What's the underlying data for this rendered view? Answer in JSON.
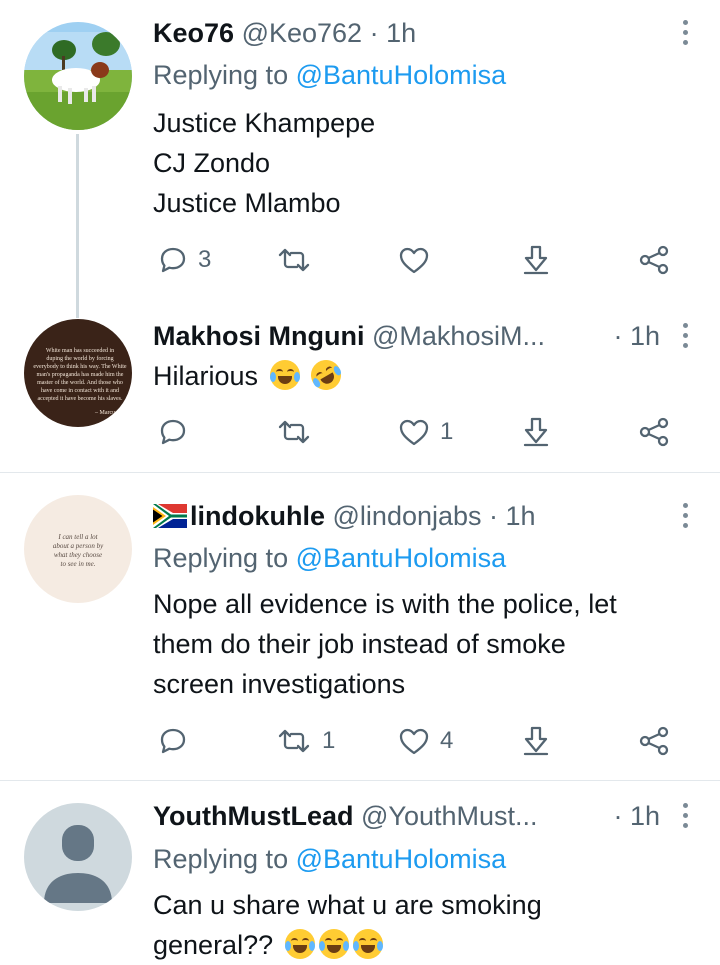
{
  "tweets": [
    {
      "name": "Keo76",
      "handle": "@Keo762",
      "time": "· 1h",
      "reply_prefix": "Replying to",
      "reply_mention": "@BantuHolomisa",
      "lines": [
        "Justice Khampepe",
        "CJ Zondo",
        "Justice Mlambo"
      ],
      "reply_count": "3",
      "retweet_count": "",
      "like_count": ""
    },
    {
      "name": "Makhosi Mnguni",
      "handle": "@MakhosiM...",
      "time": "· 1h",
      "lines": [
        "Hilarious"
      ],
      "emoji": [
        "face-with-tears-of-joy",
        "rolling-on-the-floor-laughing"
      ],
      "reply_count": "",
      "retweet_count": "",
      "like_count": "1",
      "avatar_quote": [
        "White man has succeeded in",
        "duping the world by forcing",
        "everybody to think his way. The White",
        "man's propaganda has made him the",
        "master of the world. And those who",
        "have come in contact with it and",
        "accepted it have become his slaves.",
        "– Marcus Ga"
      ]
    },
    {
      "name": "lindokuhle",
      "handle": "@lindonjabs",
      "time": "· 1h",
      "reply_prefix": "Replying to",
      "reply_mention": "@BantuHolomisa",
      "lines": [
        "Nope all evidence is with the police, let",
        "them do their job instead of smoke",
        "screen investigations"
      ],
      "reply_count": "",
      "retweet_count": "1",
      "like_count": "4",
      "avatar_quote": [
        "I can tell a lot",
        "about a person by",
        "what they choose",
        "to see in me."
      ]
    },
    {
      "name": "YouthMustLead",
      "handle": "@YouthMust...",
      "time": "· 1h",
      "reply_prefix": "Replying to",
      "reply_mention": "@BantuHolomisa",
      "lines": [
        "Can u share what u are smoking",
        "general??"
      ],
      "emoji": [
        "face-with-tears-of-joy",
        "face-with-tears-of-joy",
        "face-with-tears-of-joy"
      ]
    }
  ],
  "icons": {
    "reply": "reply-icon",
    "retweet": "retweet-icon",
    "like": "heart-icon",
    "bookmark": "bookmark-download-icon",
    "share": "share-icon",
    "more": "more-vertical-icon"
  },
  "colors": {
    "accent": "#1d9bf0",
    "secondary_text": "#536471",
    "divider": "#e3e8ec"
  }
}
